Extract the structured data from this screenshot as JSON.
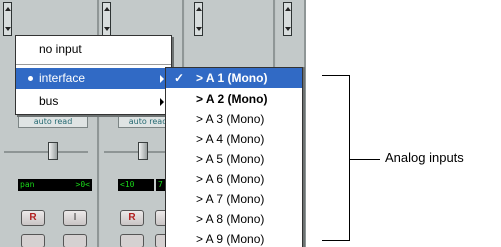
{
  "mixer": {
    "auto_modes": [
      "auto read",
      "auto read"
    ],
    "readouts": [
      "pan",
      ">0<",
      "<10",
      "7"
    ],
    "rec_label": "R",
    "input_label": "I"
  },
  "input_menu": {
    "items": [
      {
        "label": "no input",
        "submenu": false,
        "selected": false
      },
      {
        "label": "interface",
        "submenu": true,
        "selected": true
      },
      {
        "label": "bus",
        "submenu": true,
        "selected": false
      }
    ]
  },
  "interface_submenu": {
    "items": [
      {
        "label": "> A 1 (Mono)",
        "checked": true
      },
      {
        "label": "> A 2 (Mono)"
      },
      {
        "label": "> A 3 (Mono)"
      },
      {
        "label": "> A 4 (Mono)"
      },
      {
        "label": "> A 5 (Mono)"
      },
      {
        "label": "> A 6 (Mono)"
      },
      {
        "label": "> A 7 (Mono)"
      },
      {
        "label": "> A 8 (Mono)"
      },
      {
        "label": "> A 9 (Mono)"
      }
    ]
  },
  "callout": {
    "label": "Analog inputs"
  },
  "colors": {
    "highlight": "#316ac5",
    "meter_text": "#19d619"
  }
}
